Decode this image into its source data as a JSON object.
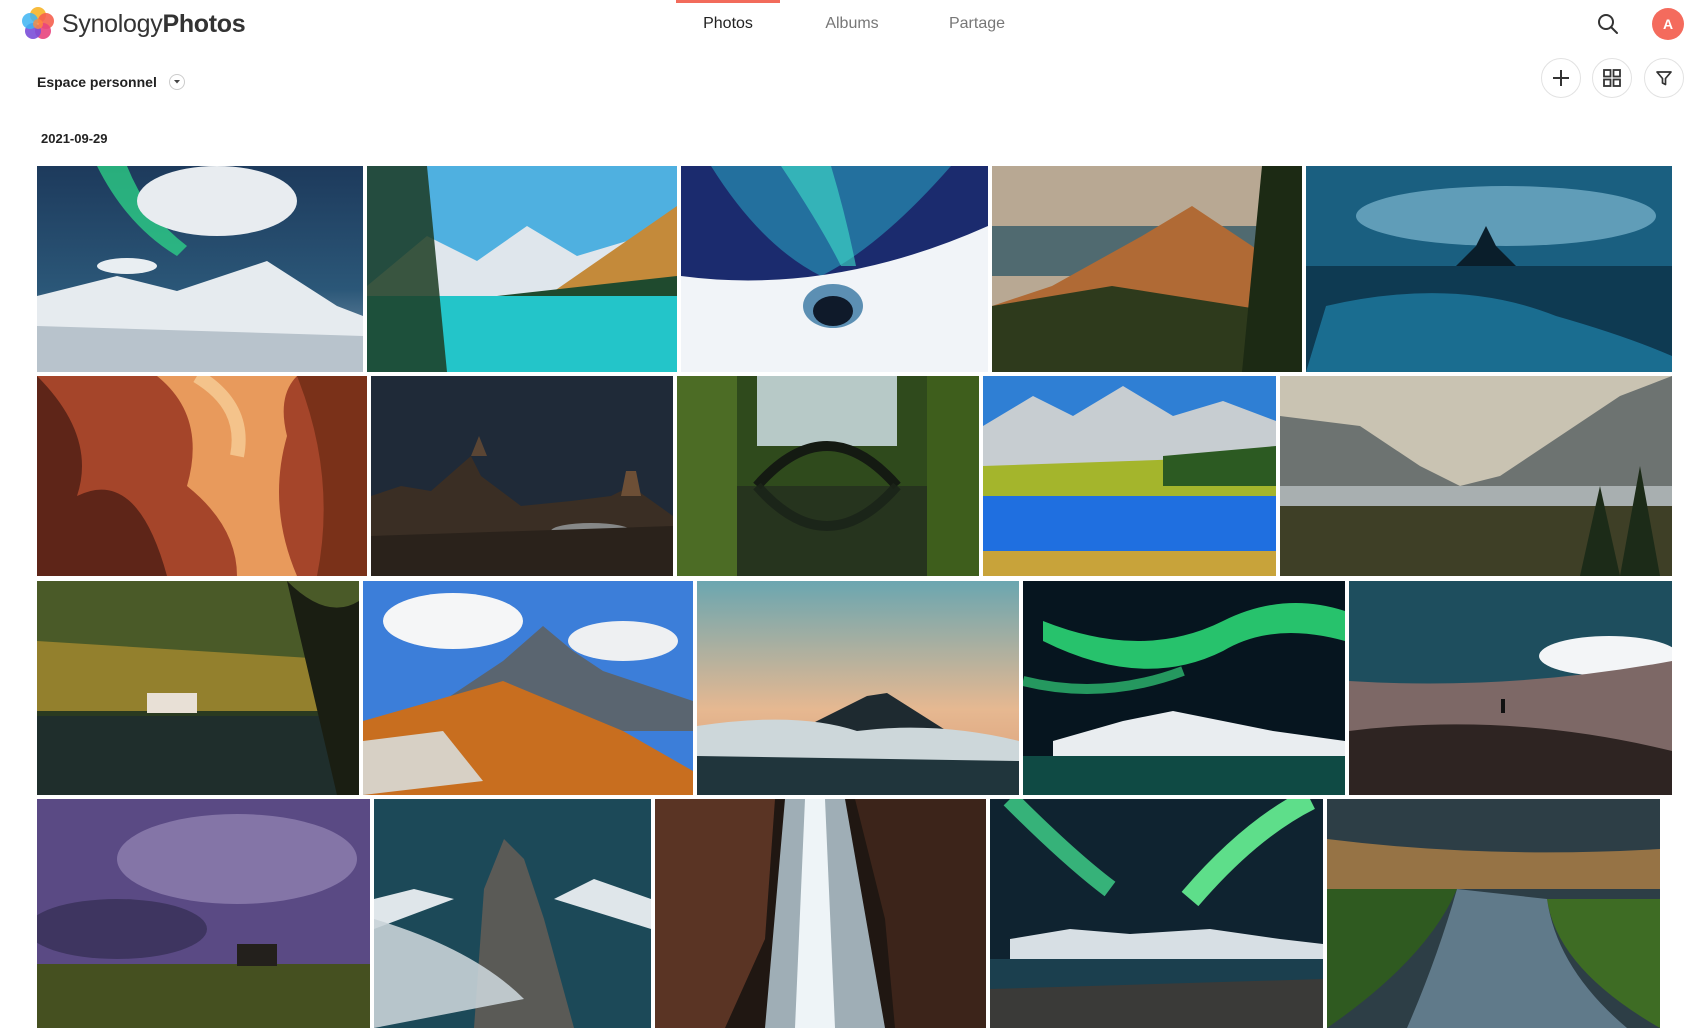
{
  "app": {
    "brand_light": "Synology",
    "brand_bold": "Photos",
    "accent_color": "#f26b5b"
  },
  "nav": {
    "tabs": [
      {
        "label": "Photos",
        "active": true
      },
      {
        "label": "Albums",
        "active": false
      },
      {
        "label": "Partage",
        "active": false
      }
    ],
    "search_icon": "search-icon",
    "avatar_initial": "A"
  },
  "toolbar": {
    "space_label": "Espace personnel",
    "add_icon": "plus-icon",
    "grid_icon": "grid-view-icon",
    "filter_icon": "filter-icon"
  },
  "timeline": {
    "date": "2021-09-29",
    "photo_count": 25
  }
}
